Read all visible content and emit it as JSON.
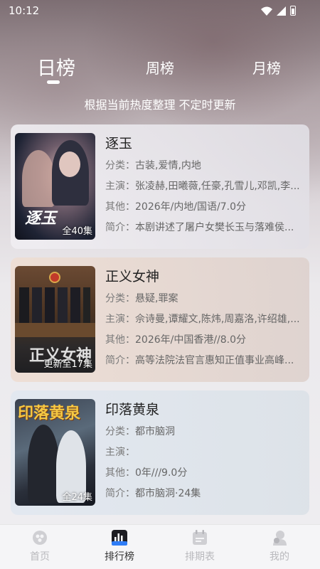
{
  "status_bar": {
    "time": "10:12"
  },
  "tabs": [
    {
      "label": "日榜",
      "active": true
    },
    {
      "label": "周榜",
      "active": false
    },
    {
      "label": "月榜",
      "active": false
    }
  ],
  "subtitle": "根据当前热度整理 不定时更新",
  "labels": {
    "genre": "分类：",
    "cast": "主演：",
    "other": "其他：",
    "summary": "简介："
  },
  "shows": [
    {
      "title": "逐玉",
      "poster_text": "逐玉",
      "badge": "全40集",
      "genre": "古装,爱情,内地",
      "cast": "张凌赫,田曦薇,任豪,孔雪儿,邓凯,李...",
      "other": "2026年/内地/国语/7.0分",
      "summary": "本剧讲述了屠户女樊长玉与落难侯..."
    },
    {
      "title": "正义女神",
      "poster_text": "正义女神",
      "badge": "更新至17集",
      "genre": "悬疑,罪案",
      "cast": "佘诗曼,谭耀文,陈炜,周嘉洛,许绍雄,...",
      "other": "2026年/中国香港//8.0分",
      "summary": "高等法院法官言惠知正值事业高峰..."
    },
    {
      "title": "印落黄泉",
      "poster_text": "印落黄泉",
      "badge": "全24集",
      "genre": "都市脑洞",
      "cast": "",
      "other": "0年///9.0分",
      "summary": "都市脑洞·24集"
    }
  ],
  "bottom_nav": [
    {
      "label": "首页",
      "icon": "home-icon",
      "active": false
    },
    {
      "label": "排行榜",
      "icon": "ranking-icon",
      "active": true
    },
    {
      "label": "排期表",
      "icon": "calendar-icon",
      "active": false
    },
    {
      "label": "我的",
      "icon": "profile-icon",
      "active": false
    }
  ],
  "colors": {
    "accent": "#2f7df6",
    "nav_inactive": "#b9b9bd"
  }
}
